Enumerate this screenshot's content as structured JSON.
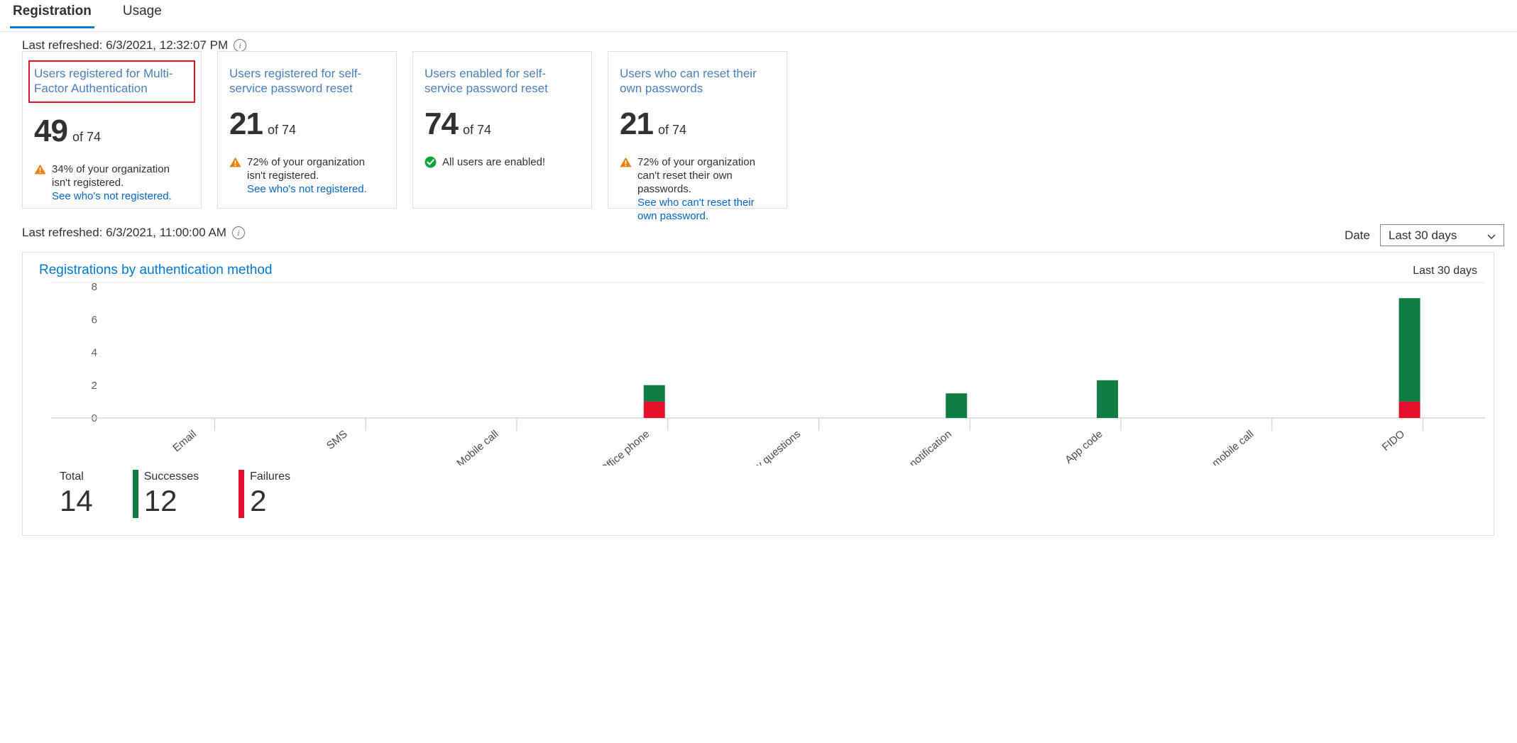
{
  "tabs": [
    {
      "label": "Registration",
      "active": true
    },
    {
      "label": "Usage",
      "active": false
    }
  ],
  "refresh_top": {
    "text": "Last refreshed: 6/3/2021, 12:32:07 PM",
    "info_glyph": "i"
  },
  "refresh_bottom": {
    "text": "Last refreshed: 6/3/2021, 11:00:00 AM",
    "info_glyph": "i"
  },
  "cards": [
    {
      "title": "Users registered for Multi-Factor Authentication",
      "value": "49",
      "of_total": "of 74",
      "status_icon": "warning-icon",
      "status_text": "34% of your organization isn't registered.",
      "status_link": "See who's not registered.",
      "highlighted": true,
      "highlight_color": "#e81123"
    },
    {
      "title": "Users registered for self-service password reset",
      "value": "21",
      "of_total": "of 74",
      "status_icon": "warning-icon",
      "status_text": "72% of your organization isn't registered.",
      "status_link": "See who's not registered.",
      "highlighted": false
    },
    {
      "title": "Users enabled for self-service password reset",
      "value": "74",
      "of_total": "of 74",
      "status_icon": "success-icon",
      "status_text": "All users are enabled!",
      "status_link": "",
      "highlighted": false
    },
    {
      "title": "Users who can reset their own passwords",
      "value": "21",
      "of_total": "of 74",
      "status_icon": "warning-icon",
      "status_text": "72% of your organization can't reset their own passwords.",
      "status_link": "See who can't reset their own password.",
      "highlighted": false
    }
  ],
  "date_filter": {
    "label": "Date",
    "selected": "Last 30 days",
    "options": [
      "Last 30 days"
    ]
  },
  "chart_panel": {
    "title": "Registrations by authentication method",
    "range_label": "Last 30 days"
  },
  "chart_data": {
    "type": "bar",
    "title": "Registrations by authentication method",
    "xlabel": "",
    "ylabel": "",
    "ylim": [
      0,
      8
    ],
    "yticks": [
      0,
      2,
      4,
      6,
      8
    ],
    "grid": false,
    "stacked": true,
    "legend": [
      "Successes",
      "Failures"
    ],
    "legend_position": "bottom",
    "categories": [
      "Email",
      "SMS",
      "Mobile call",
      "Office phone",
      "Security questions",
      "App notification",
      "App code",
      "Alternate mobile call",
      "FIDO"
    ],
    "series": [
      {
        "name": "Failures",
        "color": "#e4112b",
        "values": [
          0,
          0,
          0,
          1,
          0,
          0,
          0,
          0,
          1
        ]
      },
      {
        "name": "Successes",
        "color": "#107c41",
        "values": [
          0,
          0,
          0,
          1,
          0,
          1.5,
          2.3,
          0,
          6.3
        ]
      }
    ]
  },
  "totals": [
    {
      "label": "Total",
      "value": "14",
      "swatch": "none"
    },
    {
      "label": "Successes",
      "value": "12",
      "swatch": "#107c41"
    },
    {
      "label": "Failures",
      "value": "2",
      "swatch": "#e4112b"
    }
  ]
}
